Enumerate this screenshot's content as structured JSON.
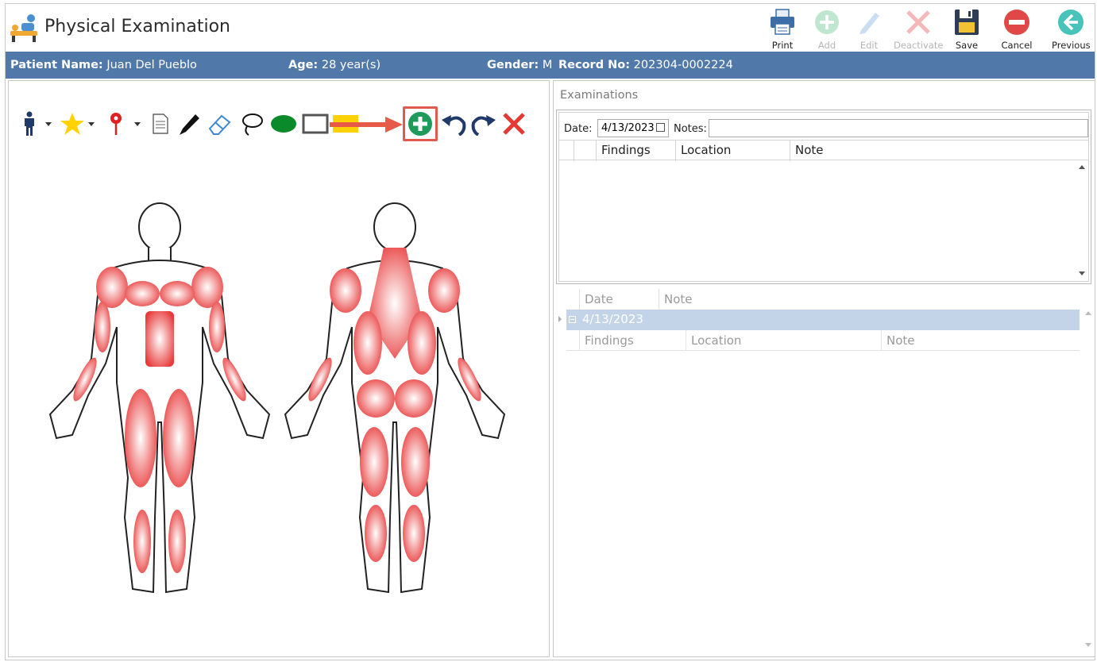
{
  "window": {
    "title": "Physical Examination"
  },
  "toolbar": {
    "print": "Print",
    "add": "Add",
    "edit": "Edit",
    "deactivate": "Deactivate",
    "save": "Save",
    "cancel": "Cancel",
    "previous": "Previous"
  },
  "patient": {
    "name_label": "Patient Name:",
    "name": "Juan Del Pueblo",
    "age_label": "Age:",
    "age": "28 year(s)",
    "gender_label": "Gender:",
    "gender": "M",
    "record_label": "Record No:",
    "record": "202304-0002224"
  },
  "drawing_tools": [
    "body-type-icon",
    "star-icon",
    "map-pin-icon",
    "document-icon",
    "pen-icon",
    "eraser-icon",
    "lasso-icon",
    "ellipse-icon",
    "rectangle-icon",
    "highlighter-icon",
    "add-icon",
    "undo-icon",
    "redo-icon",
    "clear-icon"
  ],
  "examinations": {
    "group_title": "Examinations",
    "date_label": "Date:",
    "date_value": "4/13/2023",
    "notes_label": "Notes:",
    "notes_value": "",
    "columns": [
      "Findings",
      "Location",
      "Note"
    ]
  },
  "history": {
    "columns": [
      "Date",
      "Note"
    ],
    "rows": [
      {
        "date": "4/13/2023"
      }
    ],
    "sub_columns": [
      "Findings",
      "Location",
      "Note"
    ]
  },
  "colors": {
    "header_bar": "#5079aa",
    "selected_row": "#c3d3e8",
    "muscle": "#e83a3a",
    "highlight_border": "#e05a4f"
  }
}
